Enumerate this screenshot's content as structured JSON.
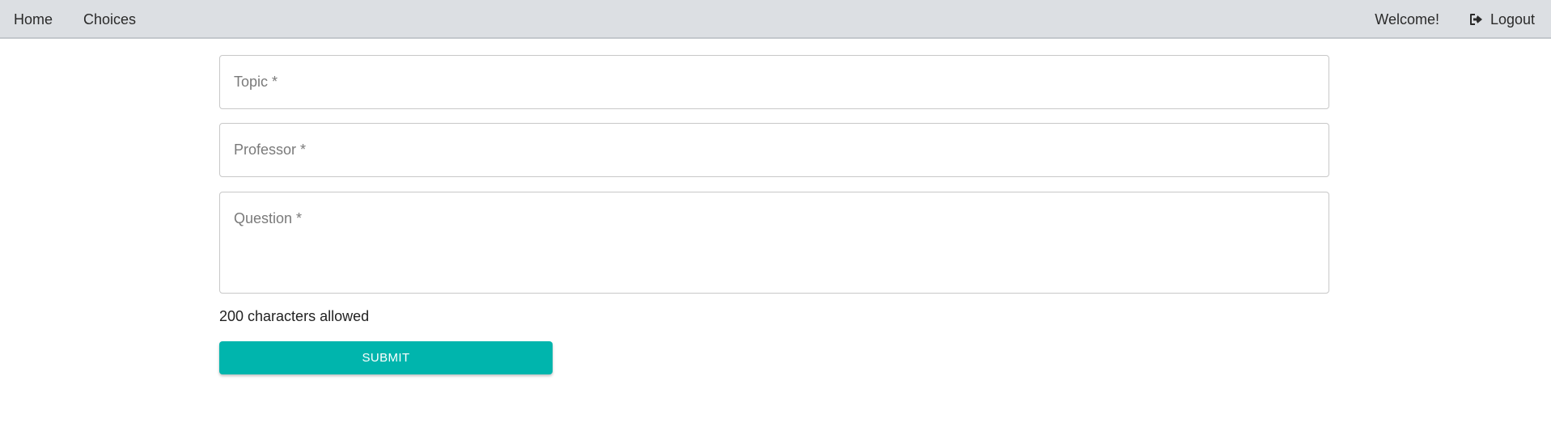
{
  "navbar": {
    "home_label": "Home",
    "choices_label": "Choices",
    "welcome_text": "Welcome!",
    "logout_label": "Logout",
    "logout_icon": "sign-out-icon",
    "background_color": "#dcdfe3"
  },
  "form": {
    "topic_label": "Topic *",
    "professor_label": "Professor *",
    "question_label": "Question *",
    "char_note": "200 characters allowed",
    "submit_label": "SUBMIT",
    "submit_color": "#00b5ad"
  }
}
